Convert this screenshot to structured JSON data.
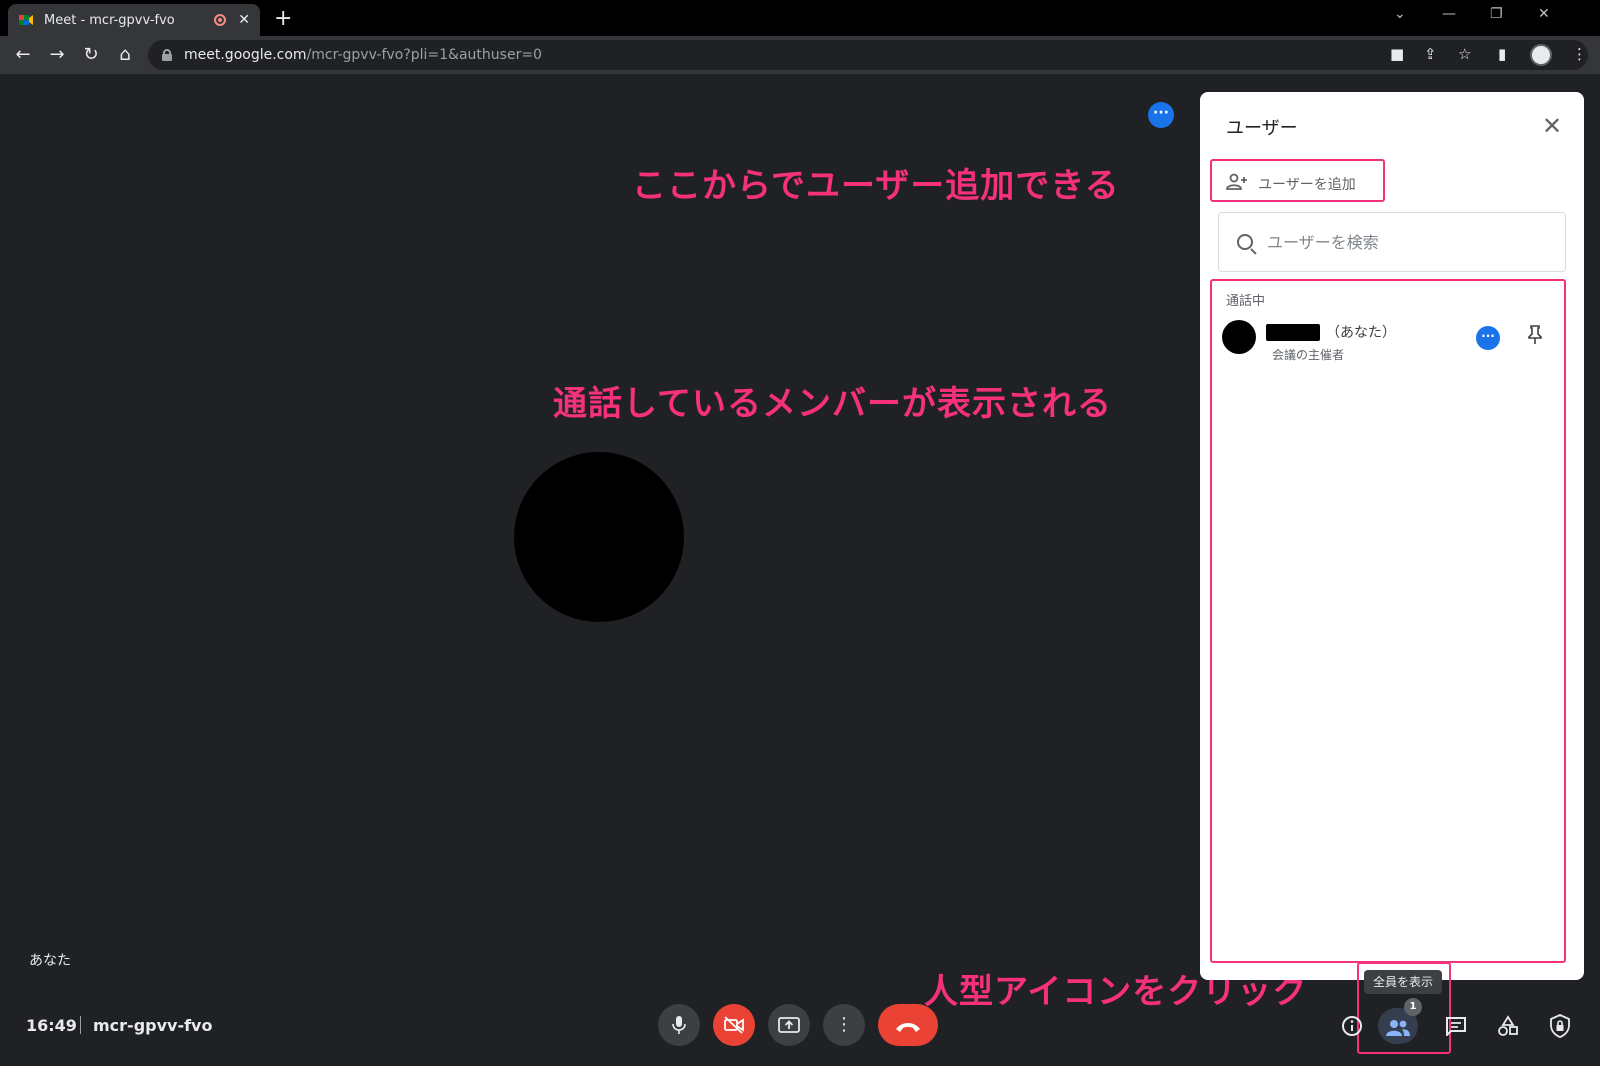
{
  "browser": {
    "tab_title": "Meet - mcr-gpvv-fvo",
    "new_tab": "+",
    "close_tab": "✕",
    "url_host": "meet.google.com",
    "url_path": "/mcr-gpvv-fvo?pli=1&authuser=0"
  },
  "meet": {
    "self_label": "あなた",
    "time": "16:49",
    "meeting_code": "mcr-gpvv-fvo"
  },
  "panel": {
    "title": "ユーザー",
    "add_user_label": "ユーザーを追加",
    "search_placeholder": "ユーザーを検索",
    "section_label": "通話中",
    "members": [
      {
        "suffix": "（あなた）",
        "role": "会議の主催者"
      }
    ]
  },
  "controls": {
    "people_tooltip": "全員を表示",
    "participant_count": "1"
  },
  "annotations": {
    "add_user_note": "ここからでユーザー追加できる",
    "members_note": "通話しているメンバーが表示される",
    "people_icon_note": "人型アイコンをクリック"
  },
  "colors": {
    "annotation": "#f4317a",
    "meet_bg": "#202124",
    "accent_blue": "#1a73e8",
    "hangup_red": "#ea4335"
  }
}
